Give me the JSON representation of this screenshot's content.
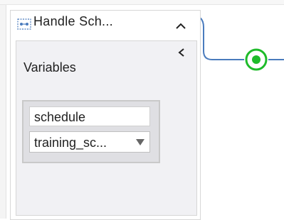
{
  "node": {
    "title": "Handle Sch...",
    "icon": "sequence-icon",
    "collapse_icon": "chevron-up-icon"
  },
  "panel": {
    "back_icon": "chevron-left-icon",
    "title": "Variables",
    "variable": {
      "name": "schedule",
      "type_selected": "training_sc..."
    },
    "dropdown_icon": "triangle-down-icon"
  },
  "connector": {
    "end_icon": "end-circle-icon",
    "wire_color": "#4a7bbd",
    "end_color": "#1ebb2a"
  }
}
